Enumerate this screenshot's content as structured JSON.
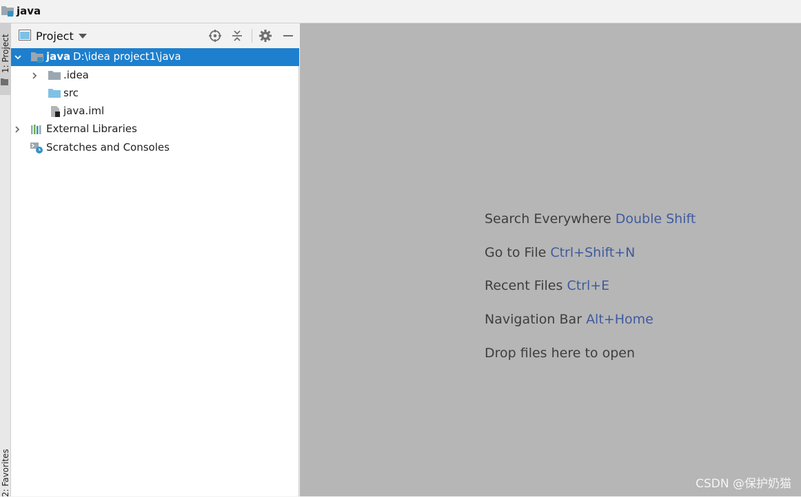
{
  "window": {
    "title": "java"
  },
  "left_toolbar": {
    "project_tab": "1: Project",
    "favorites_tab": "2: Favorites"
  },
  "project_panel": {
    "title": "Project",
    "tree": [
      {
        "label": "java",
        "path": "D:\\idea project1\\java",
        "icon": "project-folder-icon",
        "expanded": true,
        "selected": true
      },
      {
        "label": ".idea",
        "icon": "folder-icon",
        "expanded": false
      },
      {
        "label": "src",
        "icon": "source-folder-icon"
      },
      {
        "label": "java.iml",
        "icon": "iml-file-icon"
      },
      {
        "label": "External Libraries",
        "icon": "libraries-icon",
        "expanded": false
      },
      {
        "label": "Scratches and Consoles",
        "icon": "scratches-icon"
      }
    ]
  },
  "editor": {
    "hints": [
      {
        "text": "Search Everywhere",
        "shortcut": "Double Shift"
      },
      {
        "text": "Go to File",
        "shortcut": "Ctrl+Shift+N"
      },
      {
        "text": "Recent Files",
        "shortcut": "Ctrl+E"
      },
      {
        "text": "Navigation Bar",
        "shortcut": "Alt+Home"
      },
      {
        "text": "Drop files here to open",
        "shortcut": ""
      }
    ],
    "watermark": "CSDN @保护奶猫"
  },
  "colors": {
    "selection": "#1d7fce",
    "editor_bg": "#b6b6b6",
    "shortcut": "#3f5a9e",
    "folder": "#9aa7b0",
    "source_folder": "#7fc1e5"
  }
}
